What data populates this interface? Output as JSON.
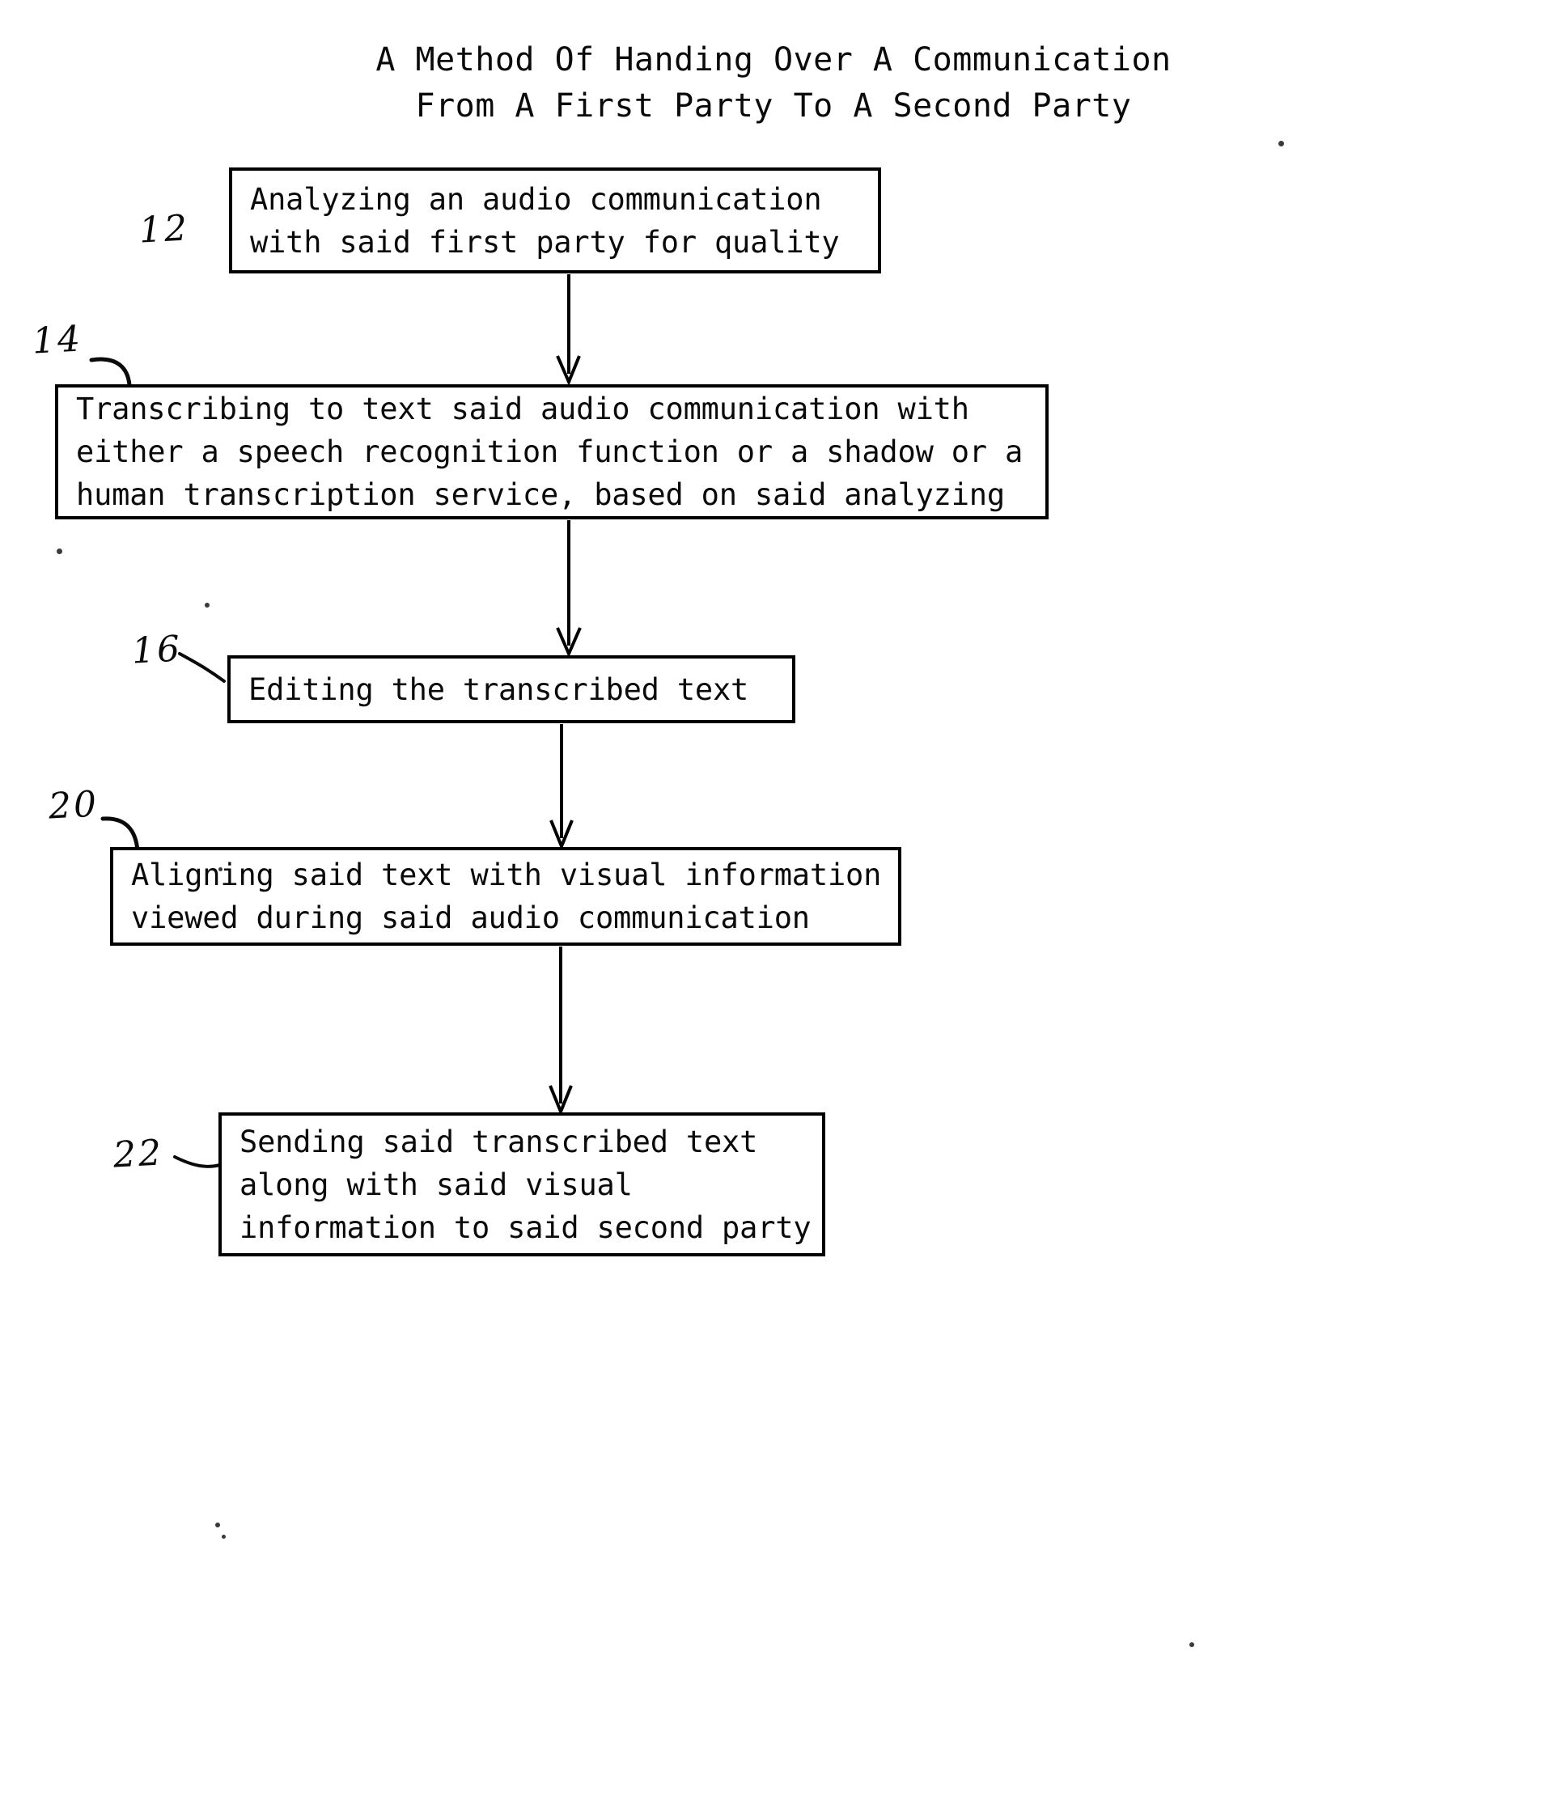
{
  "figure": {
    "title": "A Method Of Handing Over A Communication\nFrom A First Party To A Second Party",
    "title_line_1": "A Method Of Handing Over A Communication",
    "title_line_2": "From A First Party To A Second Party",
    "type": "patent-flowchart",
    "orientation": "top-to-bottom",
    "line_color": "#000000",
    "background_color": "#ffffff"
  },
  "steps": [
    {
      "ref": "12",
      "text": "Analyzing an audio communication\nwith said first party for quality"
    },
    {
      "ref": "14",
      "text": "Transcribing to text said audio communication with\neither a speech recognition function or a shadow or a\nhuman transcription service, based on said analyzing"
    },
    {
      "ref": "16",
      "text": "Editing the transcribed text"
    },
    {
      "ref": "20",
      "text": "Aligning said text with visual information\nviewed during said audio communication"
    },
    {
      "ref": "22",
      "text": "Sending said transcribed text\nalong with said visual\ninformation to said second party"
    }
  ],
  "connectors": [
    {
      "from": "12",
      "to": "14",
      "style": "arrow-down"
    },
    {
      "from": "14",
      "to": "16",
      "style": "arrow-down"
    },
    {
      "from": "16",
      "to": "20",
      "style": "arrow-down"
    },
    {
      "from": "20",
      "to": "22",
      "style": "arrow-down"
    }
  ]
}
